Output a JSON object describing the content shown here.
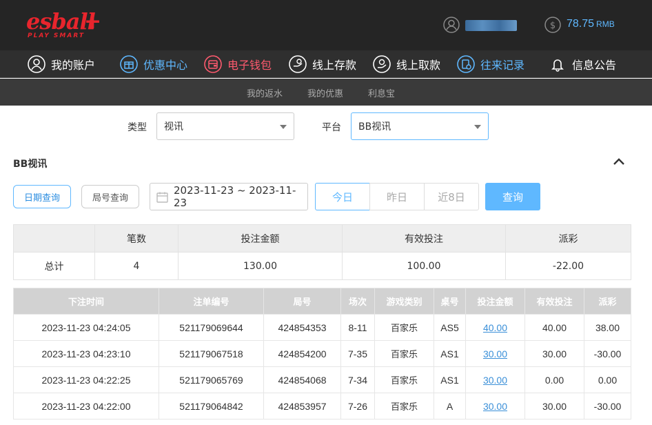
{
  "brand": {
    "logo_main": "esball",
    "logo_plus": "+",
    "logo_sub": "PLAY SMART",
    "color": "#e8252d"
  },
  "account": {
    "balance": "78.75",
    "currency": "RMB"
  },
  "nav": [
    {
      "label": "我的账户",
      "icon": "user-circle-icon"
    },
    {
      "label": "优惠中心",
      "icon": "gift-icon"
    },
    {
      "label": "电子钱包",
      "icon": "wallet-icon"
    },
    {
      "label": "线上存款",
      "icon": "deposit-icon"
    },
    {
      "label": "线上取款",
      "icon": "withdraw-icon"
    },
    {
      "label": "往来记录",
      "icon": "records-icon"
    },
    {
      "label": "信息公告",
      "icon": "bell-icon"
    }
  ],
  "subnav": [
    "我的返水",
    "我的优惠",
    "利息宝"
  ],
  "filters": {
    "type_label": "类型",
    "type_value": "视讯",
    "platform_label": "平台",
    "platform_value": "BB视讯"
  },
  "section": {
    "title": "BB视讯"
  },
  "query": {
    "date_query": "日期查询",
    "round_query": "局号查询",
    "date_range": "2023-11-23 ~ 2023-11-23",
    "ranges": [
      "今日",
      "昨日",
      "近8日"
    ],
    "search": "查询"
  },
  "summary": {
    "headers": [
      "",
      "笔数",
      "投注金额",
      "有效投注",
      "派彩"
    ],
    "row": [
      "总计",
      "4",
      "130.00",
      "100.00",
      "-22.00"
    ]
  },
  "details": {
    "headers": [
      "下注时间",
      "注单编号",
      "局号",
      "场次",
      "游戏类别",
      "桌号",
      "投注金额",
      "有效投注",
      "派彩"
    ],
    "rows": [
      [
        "2023-11-23 04:24:05",
        "521179069644",
        "424854353",
        "8-11",
        "百家乐",
        "AS5",
        "40.00",
        "40.00",
        "38.00"
      ],
      [
        "2023-11-23 04:23:10",
        "521179067518",
        "424854200",
        "7-35",
        "百家乐",
        "AS1",
        "30.00",
        "30.00",
        "-30.00"
      ],
      [
        "2023-11-23 04:22:25",
        "521179065769",
        "424854068",
        "7-34",
        "百家乐",
        "AS1",
        "30.00",
        "0.00",
        "0.00"
      ],
      [
        "2023-11-23 04:22:00",
        "521179064842",
        "424853957",
        "7-26",
        "百家乐",
        "A",
        "30.00",
        "30.00",
        "-30.00"
      ]
    ]
  },
  "colors": {
    "accent": "#5fb8ff",
    "negative": "#f25a5a",
    "promo": "#ff5a6e"
  }
}
